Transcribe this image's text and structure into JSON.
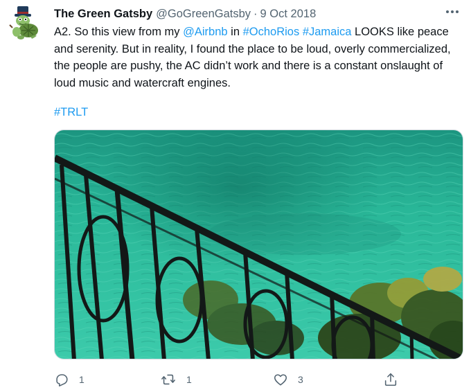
{
  "tweet": {
    "author": {
      "display_name": "The Green Gatsby",
      "handle": "@GoGreenGatsby",
      "separator": "·",
      "date": "9 Oct 2018",
      "avatar_icon": "green-gatsby-avatar-icon"
    },
    "more_icon": "more-horizontal-icon",
    "text": {
      "seg1": "A2. So this view from my ",
      "mention": "@Airbnb",
      "seg2": " in ",
      "hashtag1": "#OchoRios",
      "seg3": " ",
      "hashtag2": "#Jamaica",
      "seg4": " LOOKS like peace and serenity.  But in reality, I found the place to be loud, overly commercialized, the people are pushy, the AC didn’t work and there is a constant onslaught of loud music and watercraft engines.",
      "hashtag3": "#TRLT"
    },
    "media": {
      "icon": "turquoise-sea-balcony-photo"
    },
    "actions": {
      "reply": {
        "icon": "reply-icon",
        "count": "1"
      },
      "retweet": {
        "icon": "retweet-icon",
        "count": "1"
      },
      "like": {
        "icon": "heart-icon",
        "count": "3"
      },
      "share": {
        "icon": "share-icon"
      }
    },
    "colors": {
      "link": "#1d9bf0",
      "secondary_text": "#536471",
      "primary_text": "#0f1419",
      "sea": "#2fbfa0"
    }
  }
}
